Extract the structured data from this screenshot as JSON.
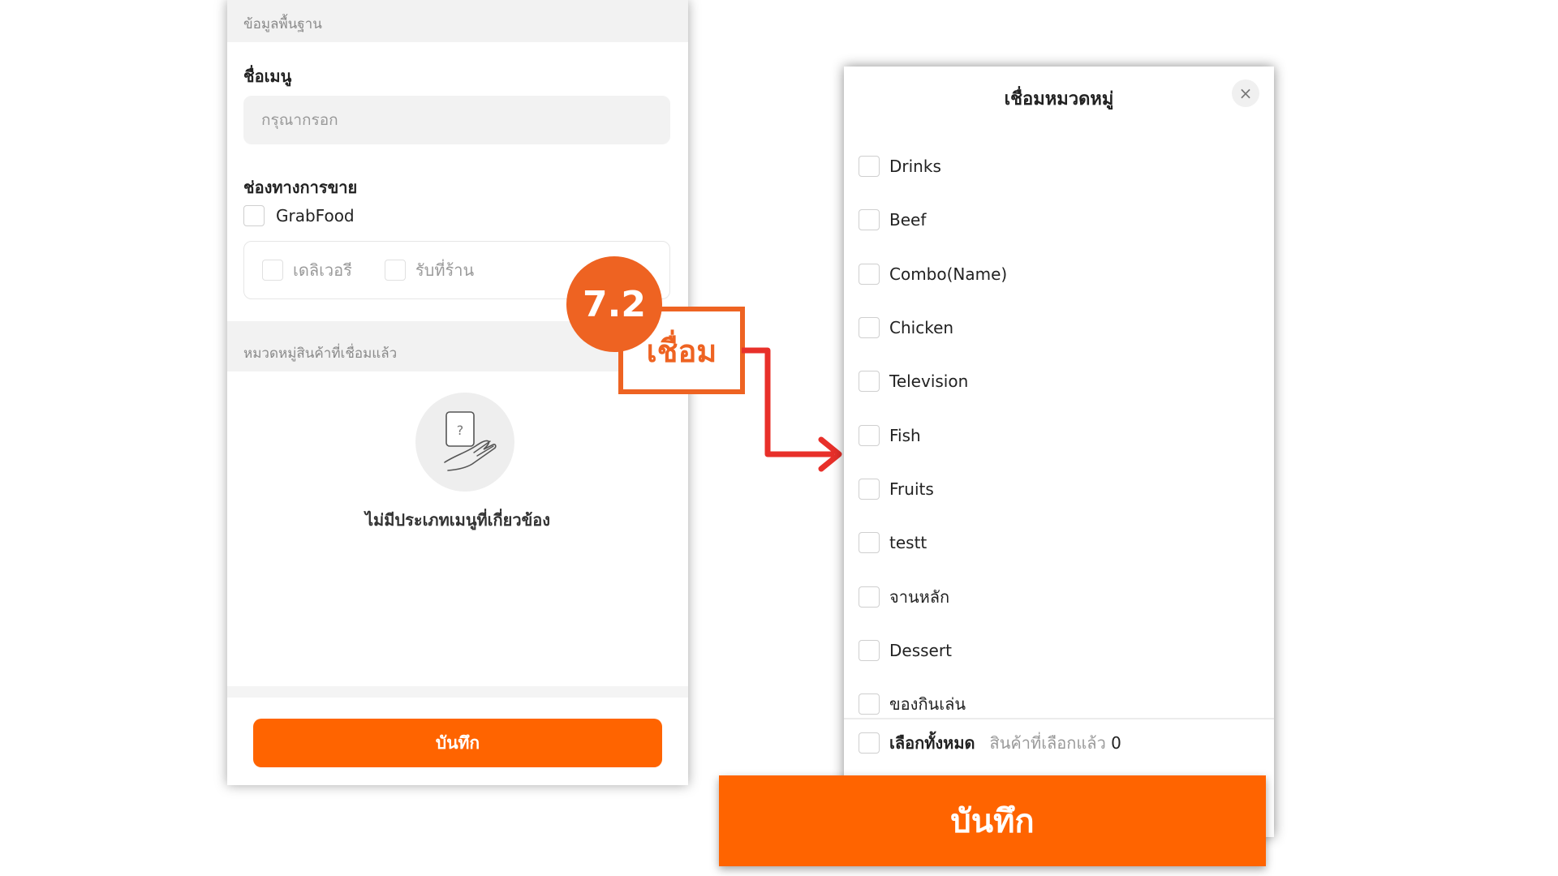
{
  "left_form": {
    "section_basic": "ข้อมูลพื้นฐาน",
    "menu_name_label": "ชื่อเมนู",
    "menu_name_placeholder": "กรุณากรอก",
    "sales_channel_label": "ช่องทางการขาย",
    "channel_grabfood": "GrabFood",
    "option_delivery": "เดลิเวอรี",
    "option_pickup": "รับที่ร้าน",
    "linked_categories_header": "หมวดหมู่สินค้าที่เชื่อมแล้ว",
    "empty_state_text": "ไม่มีประเภทเมนูที่เกี่ยวข้อง",
    "save_label": "บันทึก"
  },
  "annotation": {
    "step_number": "7.2",
    "callout_text": "เชื่อม",
    "accent_color": "#ee6322",
    "arrow_color": "#e8302a"
  },
  "dialog": {
    "title": "เชื่อมหมวดหมู่",
    "close_icon": "×",
    "categories": [
      {
        "label": "Drinks",
        "checked": false
      },
      {
        "label": "Beef",
        "checked": false
      },
      {
        "label": "Combo(Name)",
        "checked": false
      },
      {
        "label": "Chicken",
        "checked": false
      },
      {
        "label": "Television",
        "checked": false
      },
      {
        "label": "Fish",
        "checked": false
      },
      {
        "label": "Fruits",
        "checked": false
      },
      {
        "label": "testt",
        "checked": false
      },
      {
        "label": "จานหลัก",
        "checked": false
      },
      {
        "label": "Dessert",
        "checked": false
      },
      {
        "label": "ของกินเล่น",
        "checked": false
      }
    ],
    "select_all_label": "เลือกทั้งหมด",
    "selected_count_label": "สินค้าที่เลือกแล้ว",
    "selected_count": "0",
    "save_label": "บันทึก"
  },
  "colors": {
    "primary_orange": "#ff6400"
  }
}
